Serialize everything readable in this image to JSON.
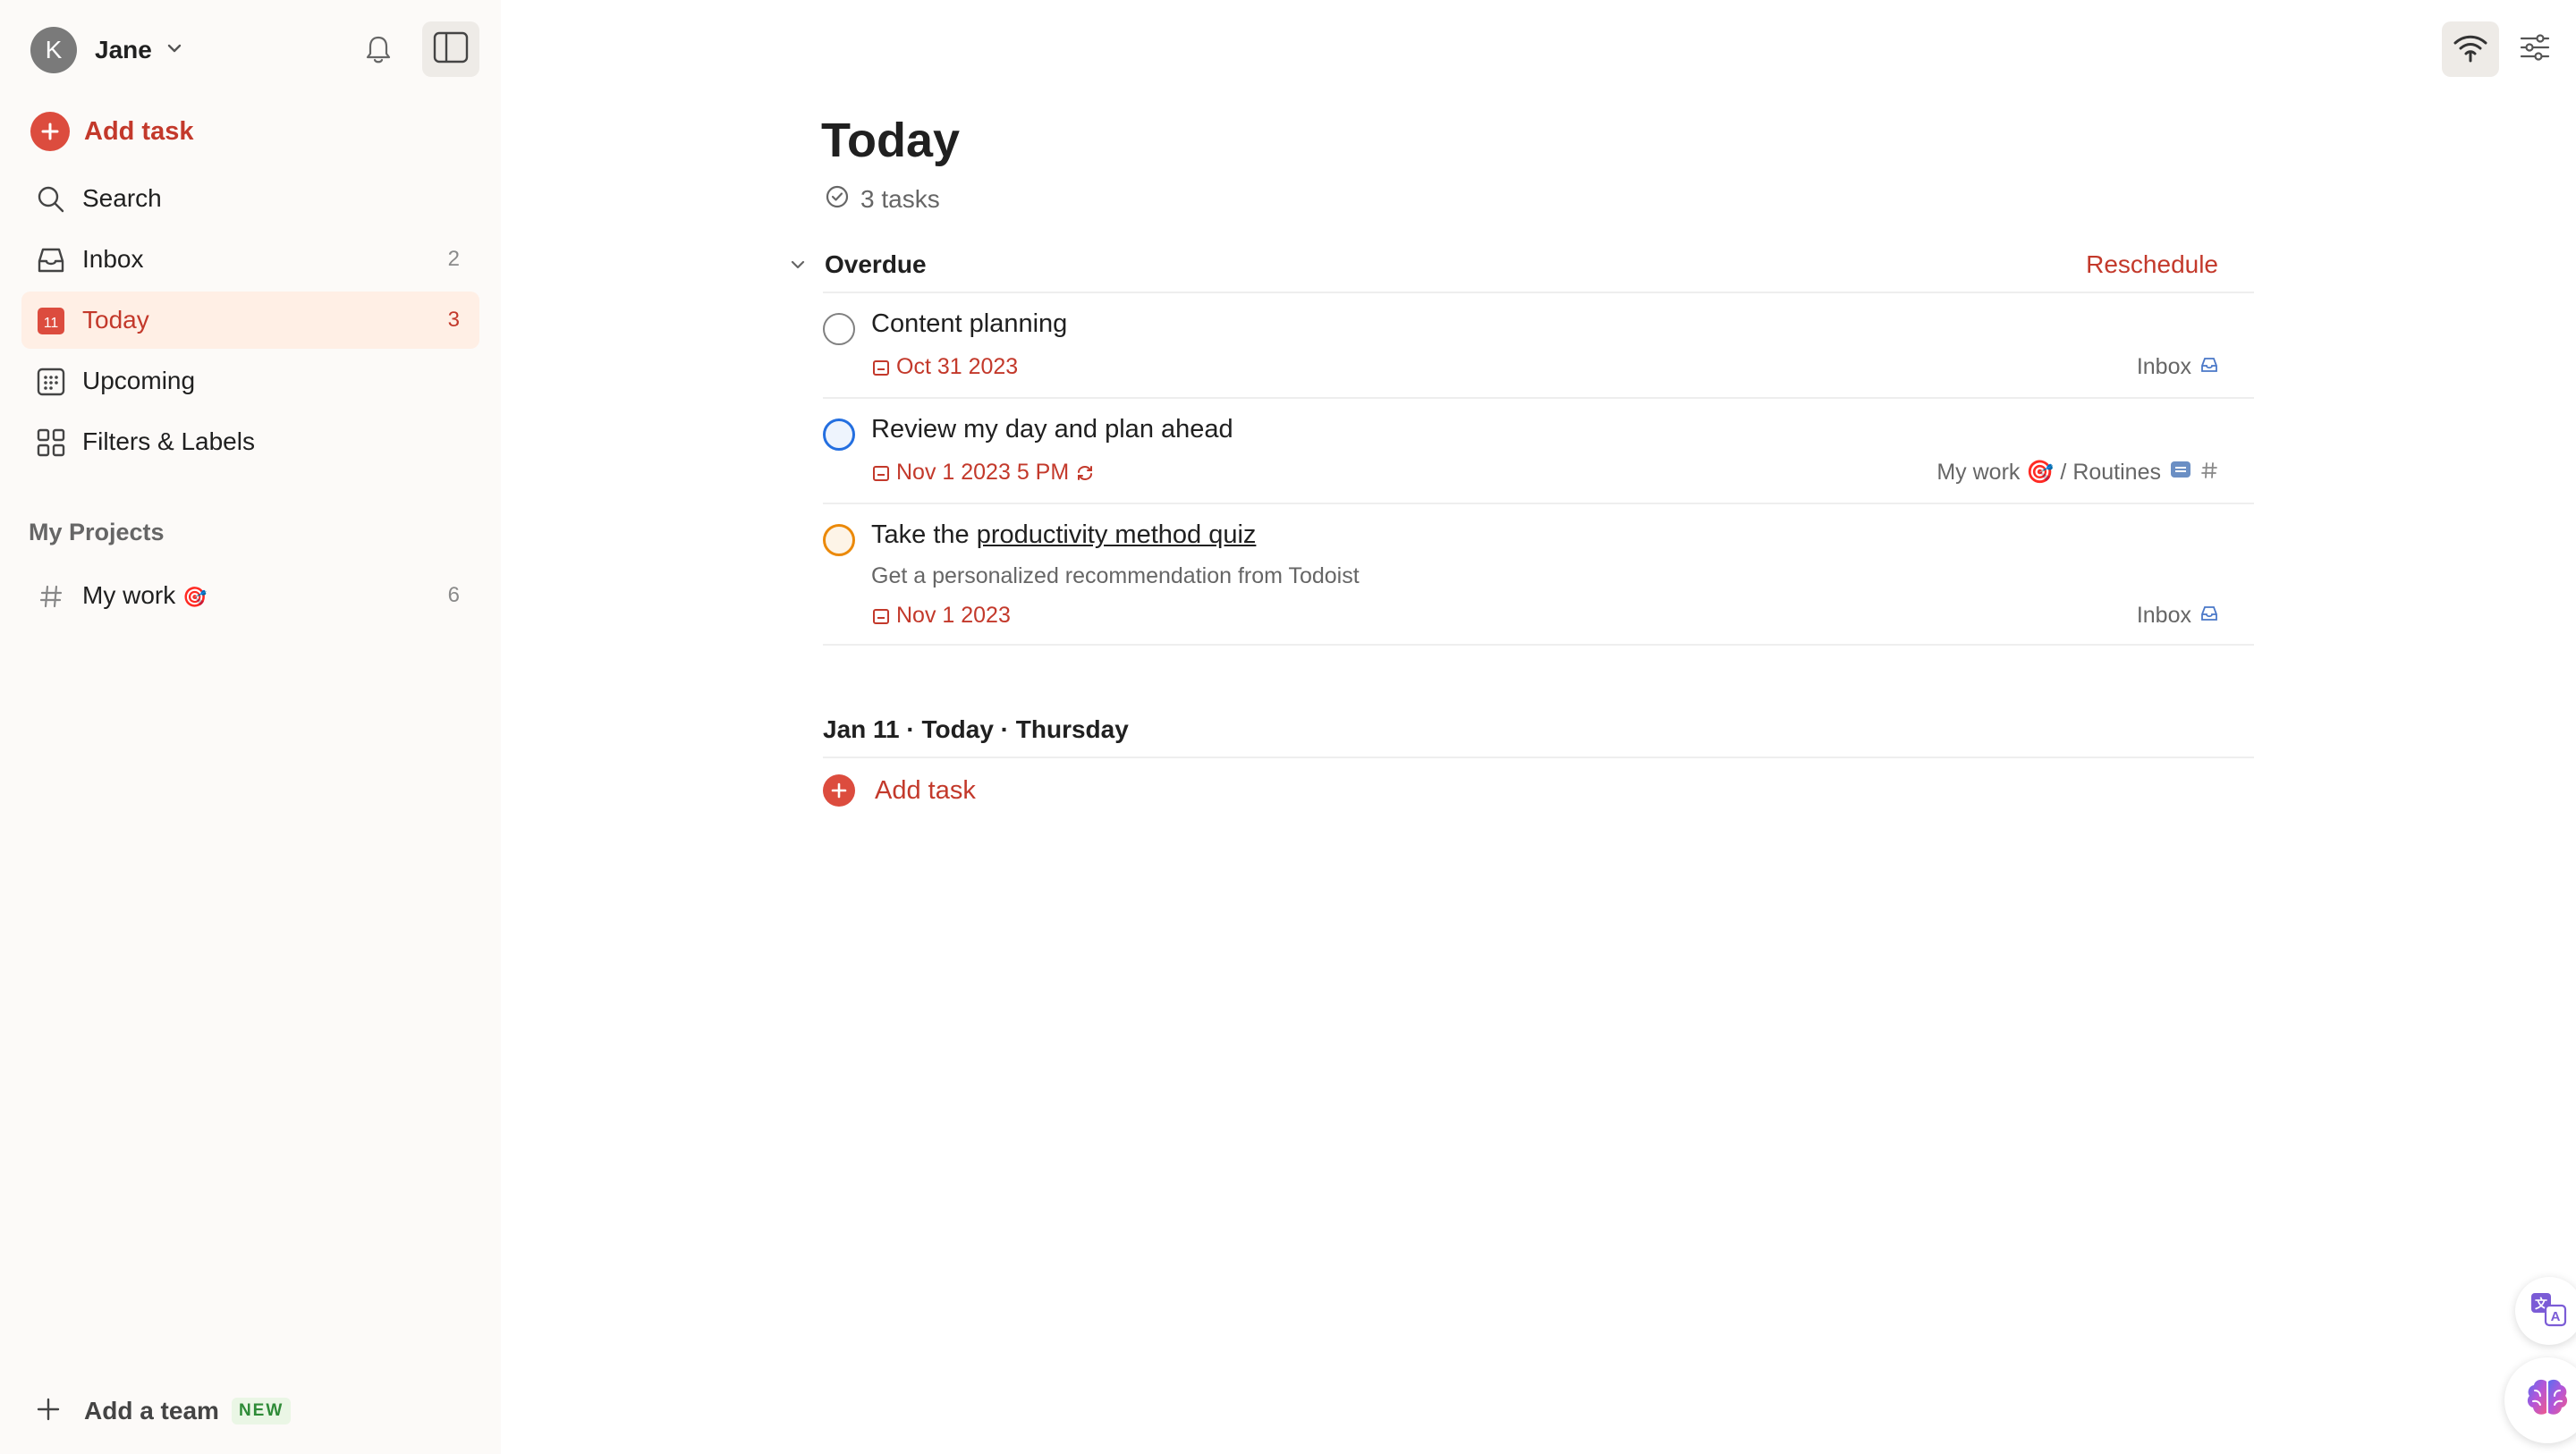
{
  "sidebar": {
    "user": {
      "initial": "K",
      "name": "Jane"
    },
    "add_task": "Add task",
    "nav": [
      {
        "label": "Search",
        "count": ""
      },
      {
        "label": "Inbox",
        "count": "2"
      },
      {
        "label": "Today",
        "count": "3",
        "icon_text": "11"
      },
      {
        "label": "Upcoming",
        "count": ""
      },
      {
        "label": "Filters & Labels",
        "count": ""
      }
    ],
    "projects_heading": "My Projects",
    "projects": [
      {
        "label": "My work",
        "emoji": "🎯",
        "count": "6"
      }
    ],
    "add_team": "Add a team",
    "new_badge": "NEW"
  },
  "main": {
    "title": "Today",
    "task_count": "3 tasks",
    "overdue": {
      "title": "Overdue",
      "reschedule": "Reschedule",
      "tasks": [
        {
          "title": "Content planning",
          "date": "Oct 31 2023",
          "project": "Inbox",
          "priority": "none"
        },
        {
          "title": "Review my day and plan ahead",
          "date": "Nov 1 2023 5 PM",
          "project": "My work 🎯 / Routines",
          "priority": "p2",
          "recurring": true
        },
        {
          "title_prefix": "Take the ",
          "title_link": "productivity method quiz",
          "description": "Get a personalized recommendation from Todoist",
          "date": "Nov 1 2023",
          "project": "Inbox",
          "priority": "p3"
        }
      ]
    },
    "today_section": {
      "title": "Jan 11 · Today · Thursday"
    },
    "add_task": "Add task"
  },
  "colors": {
    "accent": "#dc4c3e",
    "accent_text": "#c3392b",
    "p2": "#246fe0",
    "p3": "#eb8909",
    "sidebar_bg": "#fcfaf8",
    "active_bg": "#ffefe5"
  },
  "icons": [
    "chevron-down-icon",
    "bell-icon",
    "sidebar-toggle-icon",
    "plus-icon",
    "search-icon",
    "inbox-icon",
    "calendar-today-icon",
    "upcoming-grid-icon",
    "filters-grid-icon",
    "hash-icon",
    "wifi-icon",
    "settings-sliders-icon",
    "check-circle-icon",
    "calendar-icon",
    "recurring-icon",
    "translate-icon",
    "brain-icon"
  ]
}
